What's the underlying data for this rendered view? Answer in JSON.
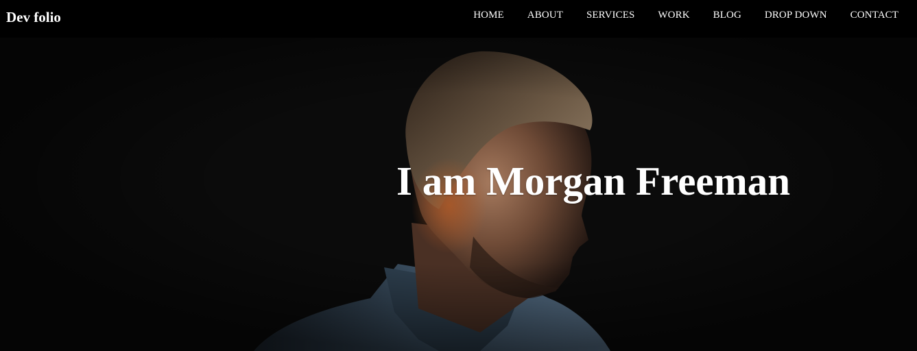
{
  "navbar": {
    "brand": "Dev folio",
    "items": [
      {
        "label": "HOME"
      },
      {
        "label": "ABOUT"
      },
      {
        "label": "SERVICES"
      },
      {
        "label": "WORK"
      },
      {
        "label": "BLOG"
      },
      {
        "label": "DROP DOWN"
      },
      {
        "label": "CONTACT"
      }
    ]
  },
  "hero": {
    "title": "I am Morgan Freeman",
    "background": "portrait-photo"
  },
  "colors": {
    "navbar_bg": "#000000",
    "hero_bg": "#0b0b0b",
    "text": "#ffffff"
  }
}
